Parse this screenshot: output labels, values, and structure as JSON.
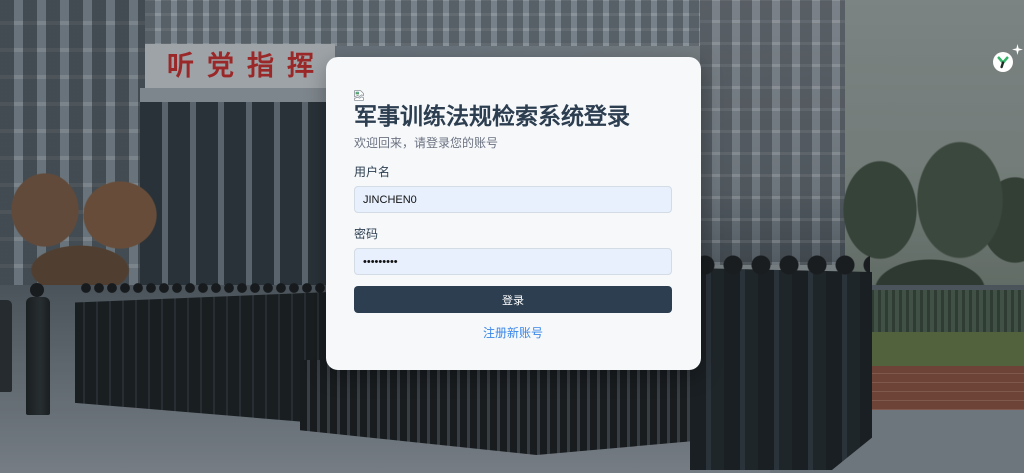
{
  "background": {
    "sign_text": "听党指挥"
  },
  "login": {
    "title": "军事训练法规检索系统登录",
    "subtitle": "欢迎回来，请登录您的账号",
    "username_label": "用户名",
    "username_value": "JINCHEN0",
    "password_label": "密码",
    "password_value": "•••••••••",
    "submit_label": "登录",
    "register_link": "注册新账号"
  },
  "icons": {
    "logo": "broken-image-icon",
    "extension_badge": "y-badge-icon",
    "extension_sparkle": "sparkle-icon"
  },
  "colors": {
    "title": "#2c3e50",
    "button_bg": "#2c3e50",
    "link": "#3a86e8",
    "input_autofill_bg": "#e8f0fe",
    "card_bg": "#f6f8fa"
  }
}
